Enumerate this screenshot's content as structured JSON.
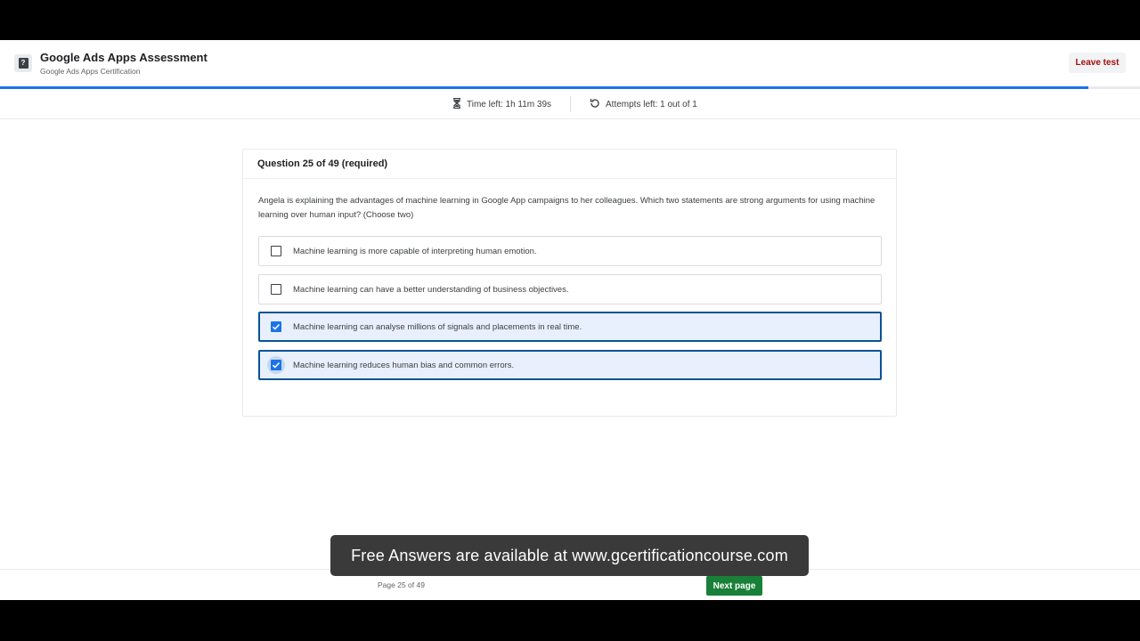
{
  "header": {
    "title": "Google Ads Apps Assessment",
    "subtitle": "Google Ads Apps Certification",
    "leave_label": "Leave test",
    "leave_color": "#a50e0e"
  },
  "progress": {
    "fraction": 0.955,
    "color": "#1a73e8"
  },
  "info": {
    "time_left": "Time left: 1h 11m 39s",
    "attempts_left": "Attempts left: 1 out of 1"
  },
  "question": {
    "heading": "Question 25 of 49 (required)",
    "text": "Angela is explaining the advantages of machine learning in Google App campaigns to her colleagues. Which two statements are strong arguments for using machine learning over human input? (Choose two)",
    "options": [
      {
        "label": "Machine learning is more capable of interpreting human emotion.",
        "checked": false
      },
      {
        "label": "Machine learning can have a better understanding of business objectives.",
        "checked": false
      },
      {
        "label": "Machine learning can analyse millions of signals and placements in real time.",
        "checked": true
      },
      {
        "label": "Machine learning reduces human bias and common errors.",
        "checked": true
      }
    ]
  },
  "footer": {
    "page_label": "Page 25 of 49",
    "next_label": "Next page",
    "next_color": "#188038"
  },
  "banner": {
    "text": "Free Answers are available at www.gcertificationcourse.com"
  }
}
